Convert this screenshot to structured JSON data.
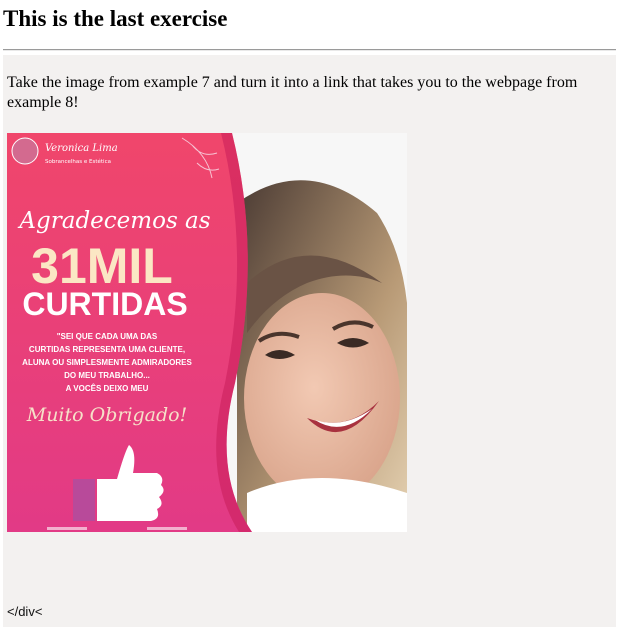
{
  "page": {
    "title": "This is the last exercise",
    "instructions": "Take the image from example 7 and turn it into a link that takes you to the webpage from example 8!",
    "raw_text": "</div<"
  },
  "image": {
    "brand_name": "Veronica Lima",
    "brand_subtitle": "Sobrancelhas e Estética",
    "headline": "Agradecemos as",
    "big_number": "31MIL",
    "big_word": "CURTIDAS",
    "message_lines": [
      "\"SEI QUE CADA UMA DAS",
      "CURTIDAS REPRESENTA UMA CLIENTE,",
      "ALUNA OU SIMPLESMENTE ADMIRADORES",
      "DO MEU TRABALHO...",
      "A VOCÊS DEIXO MEU"
    ],
    "signoff": "Muito Obrigado!",
    "icon": "thumbs-up-icon"
  },
  "colors": {
    "panel_bg": "#f3f1f0",
    "poster_pink_top": "#f0466b",
    "poster_pink_bottom": "#e23a86"
  }
}
